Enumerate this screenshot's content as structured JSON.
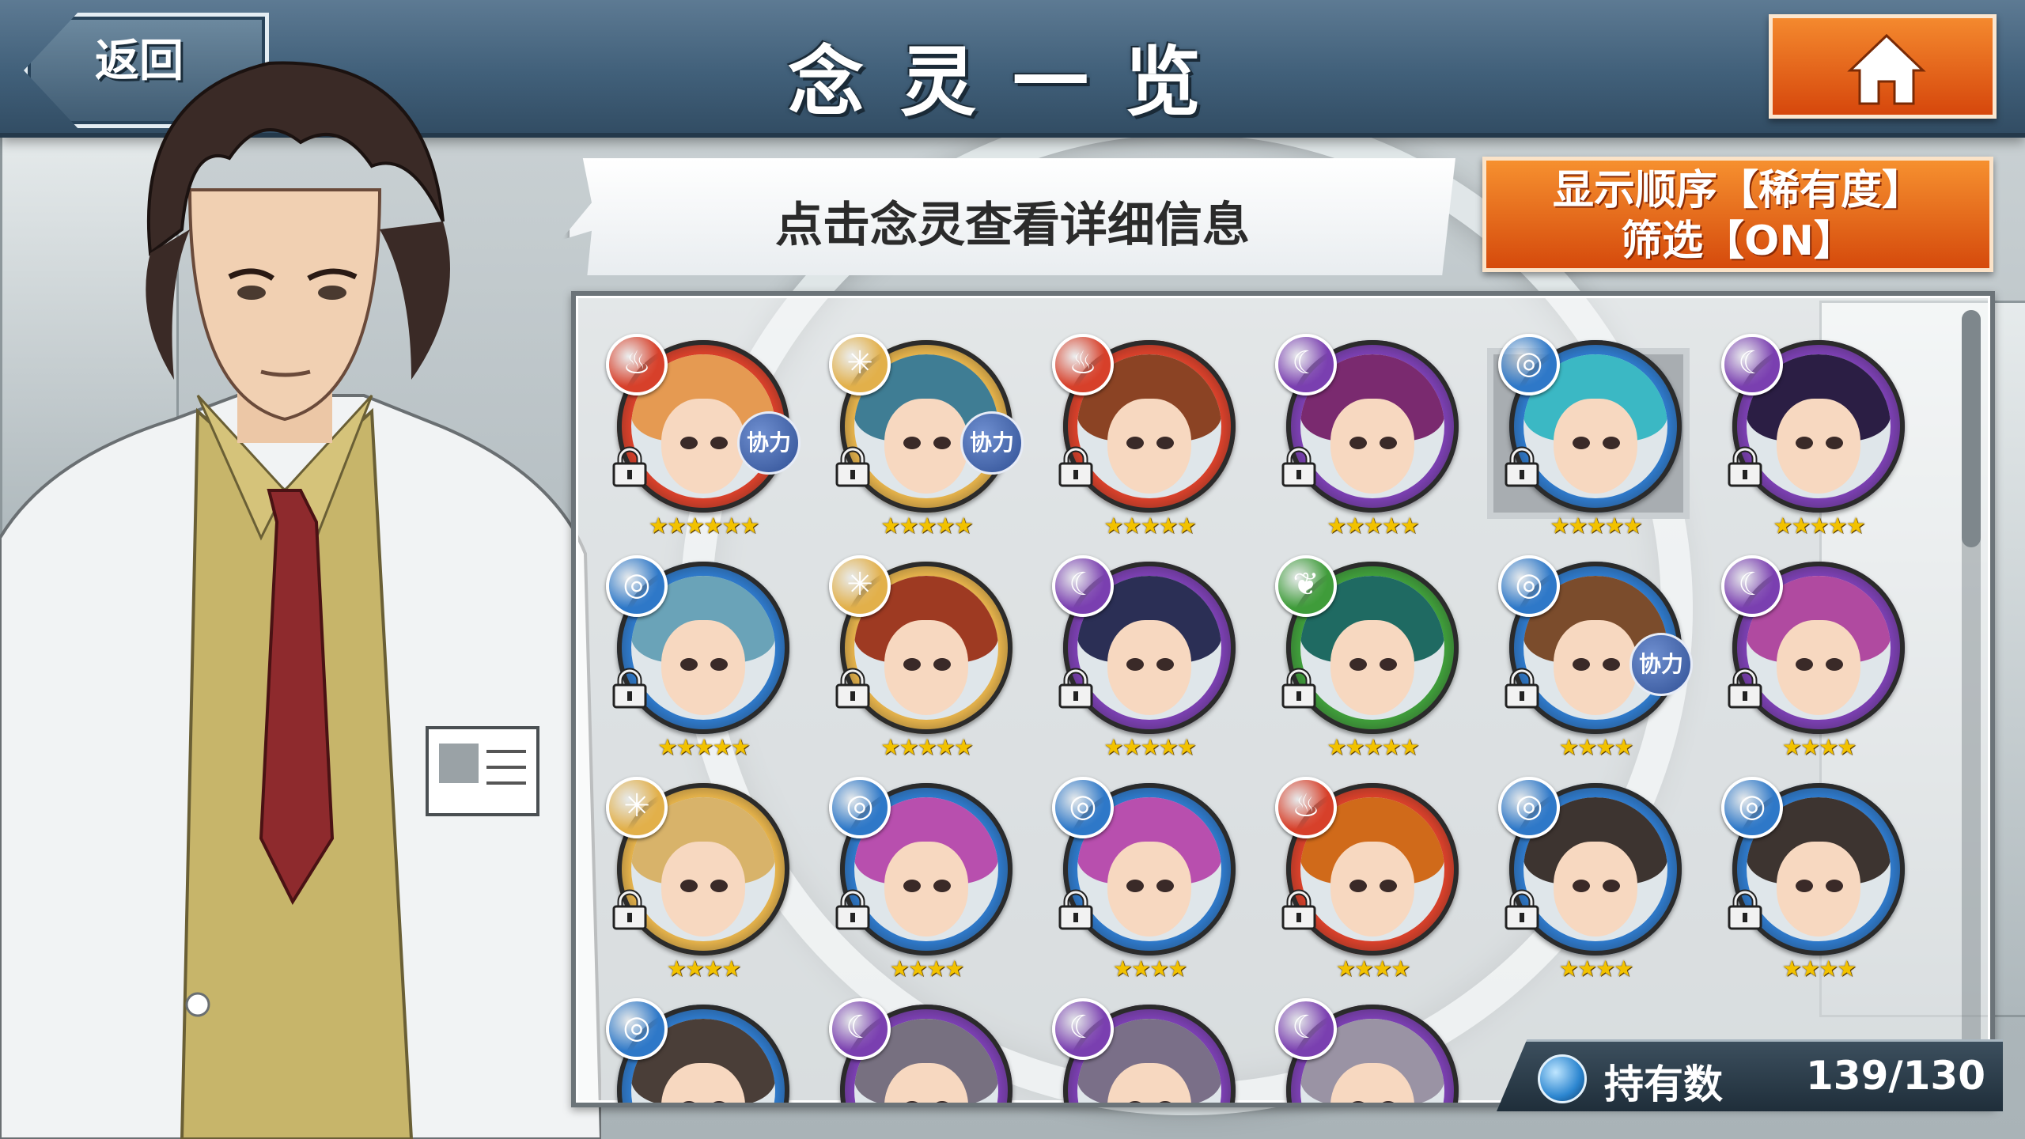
{
  "header": {
    "title": "念灵一览",
    "back_label": "返回",
    "home_icon": "home-icon"
  },
  "hint_bubble": {
    "text": "点击念灵查看详细信息"
  },
  "sort_button": {
    "line1": "显示顺序【稀有度】",
    "line2": "筛选【ON】"
  },
  "owned": {
    "label": "持有数",
    "value": "139/130"
  },
  "colors": {
    "fire": "#d7402a",
    "light": "#e2b04a",
    "dark": "#7a3fb0",
    "water": "#2e78c8",
    "wood": "#3f9c3a"
  },
  "units": [
    {
      "element": "fire",
      "stars": 6,
      "collab": true,
      "hair": "#e59a52"
    },
    {
      "element": "light",
      "stars": 5,
      "collab": true,
      "hair": "#3f7d94"
    },
    {
      "element": "fire",
      "stars": 5,
      "collab": false,
      "hair": "#8b4324"
    },
    {
      "element": "dark",
      "stars": 5,
      "collab": false,
      "hair": "#7a2a6f"
    },
    {
      "element": "water",
      "stars": 5,
      "collab": false,
      "hair": "#3bb8c4"
    },
    {
      "element": "dark",
      "stars": 5,
      "collab": false,
      "hair": "#2b1e44"
    },
    {
      "element": "water",
      "stars": 5,
      "collab": false,
      "hair": "#6aa3b8"
    },
    {
      "element": "light",
      "stars": 5,
      "collab": false,
      "hair": "#9e3a22"
    },
    {
      "element": "dark",
      "stars": 5,
      "collab": false,
      "hair": "#2b2f55"
    },
    {
      "element": "wood",
      "stars": 5,
      "collab": false,
      "hair": "#1f6a62"
    },
    {
      "element": "water",
      "stars": 4,
      "collab": true,
      "hair": "#7b4c2c"
    },
    {
      "element": "dark",
      "stars": 4,
      "collab": false,
      "hair": "#b04aa0"
    },
    {
      "element": "light",
      "stars": 4,
      "collab": false,
      "hair": "#d8b36a"
    },
    {
      "element": "water",
      "stars": 4,
      "collab": false,
      "hair": "#b84fae"
    },
    {
      "element": "water",
      "stars": 4,
      "collab": false,
      "hair": "#b84fae"
    },
    {
      "element": "fire",
      "stars": 4,
      "collab": false,
      "hair": "#d06a1a"
    },
    {
      "element": "water",
      "stars": 4,
      "collab": false,
      "hair": "#3d3430"
    },
    {
      "element": "water",
      "stars": 4,
      "collab": false,
      "hair": "#3d3430"
    },
    {
      "element": "water",
      "stars": 0,
      "collab": false,
      "hair": "#4a3e38"
    },
    {
      "element": "dark",
      "stars": 0,
      "collab": false,
      "hair": "#777080"
    },
    {
      "element": "dark",
      "stars": 0,
      "collab": false,
      "hair": "#7a6f88"
    },
    {
      "element": "dark",
      "stars": 0,
      "collab": false,
      "hair": "#9a93a4"
    }
  ],
  "collab_label": "协力"
}
